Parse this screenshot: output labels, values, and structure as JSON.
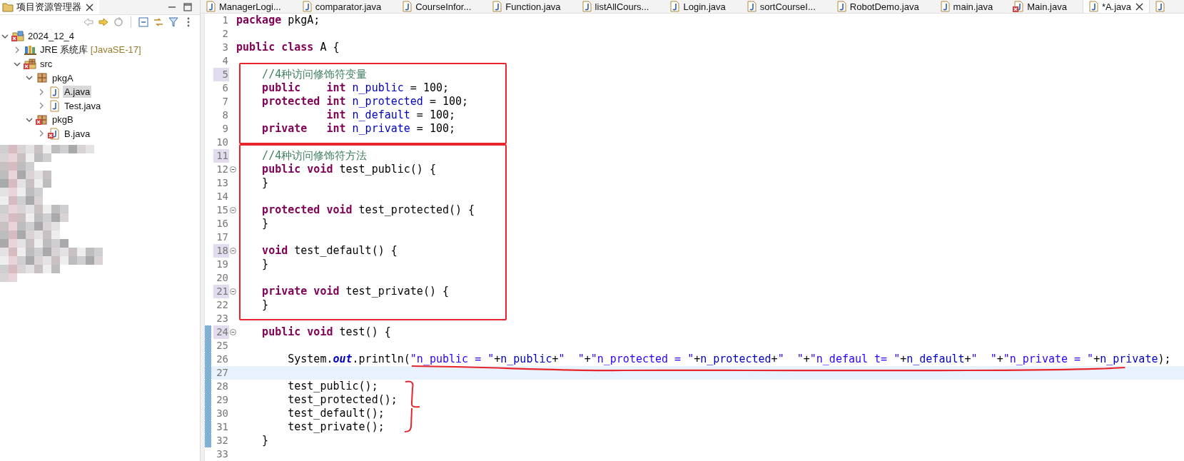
{
  "explorer": {
    "title": "项目资源管理器",
    "obscured": true,
    "tree": [
      {
        "label": "2024_12_4",
        "kind": "project",
        "error": true,
        "expanded": true,
        "selected": false,
        "children": [
          {
            "label": "JRE 系统库",
            "decoration": "[JavaSE-17]",
            "kind": "library",
            "error": false,
            "expanded": false,
            "selected": false
          },
          {
            "label": "src",
            "kind": "source-folder",
            "error": true,
            "expanded": true,
            "selected": false,
            "children": [
              {
                "label": "pkgA",
                "kind": "package",
                "error": false,
                "expanded": true,
                "selected": false,
                "children": [
                  {
                    "label": "A.java",
                    "kind": "java-file",
                    "error": false,
                    "expanded": false,
                    "selected": true
                  },
                  {
                    "label": "Test.java",
                    "kind": "java-file",
                    "error": false,
                    "expanded": false,
                    "selected": false
                  }
                ]
              },
              {
                "label": "pkgB",
                "kind": "package",
                "error": true,
                "expanded": true,
                "selected": false,
                "children": [
                  {
                    "label": "B.java",
                    "kind": "java-file",
                    "error": true,
                    "expanded": false,
                    "selected": false
                  }
                ]
              }
            ]
          }
        ]
      }
    ]
  },
  "editor": {
    "tabs": [
      {
        "label": "ManagerLogi...",
        "selected": false,
        "error": false
      },
      {
        "label": "comparator.java",
        "selected": false,
        "error": false
      },
      {
        "label": "CourseInfor...",
        "selected": false,
        "error": false
      },
      {
        "label": "Function.java",
        "selected": false,
        "error": false
      },
      {
        "label": "listAllCours...",
        "selected": false,
        "error": false
      },
      {
        "label": "Login.java",
        "selected": false,
        "error": false
      },
      {
        "label": "sortCourseI...",
        "selected": false,
        "error": false
      },
      {
        "label": "RobotDemo.java",
        "selected": false,
        "error": false
      },
      {
        "label": "main.java",
        "selected": false,
        "error": false
      },
      {
        "label": "Main.java",
        "selected": false,
        "error": true
      },
      {
        "label": "*A.java",
        "selected": true,
        "error": false
      },
      {
        "selected": false,
        "error": false
      }
    ],
    "lines": [
      {
        "number": "1",
        "tokens": [
          {
            "kind": "keyword",
            "text": "package"
          },
          {
            "kind": "plain",
            "text": " pkgA;"
          }
        ],
        "current": false,
        "changed": false,
        "marked": false,
        "foldable": false
      },
      {
        "number": "2",
        "current": false,
        "changed": false,
        "marked": false,
        "foldable": false
      },
      {
        "number": "3",
        "tokens": [
          {
            "kind": "keyword",
            "text": "public"
          },
          {
            "kind": "keyword",
            "text": " class"
          },
          {
            "kind": "plain",
            "text": " A {"
          }
        ],
        "current": false,
        "changed": false,
        "marked": false,
        "foldable": false
      },
      {
        "number": "4",
        "current": false,
        "changed": false,
        "marked": false,
        "foldable": false
      },
      {
        "number": "5",
        "tokens": [
          {
            "kind": "comment",
            "text": "    //4种访问修饰符变量"
          }
        ],
        "current": false,
        "changed": false,
        "marked": true,
        "foldable": false
      },
      {
        "number": "6",
        "tokens": [
          {
            "kind": "keyword",
            "text": "    public"
          },
          {
            "kind": "keyword",
            "text": "    int"
          },
          {
            "kind": "field",
            "text": " n_public"
          },
          {
            "kind": "plain",
            "text": " = 100;"
          }
        ],
        "current": false,
        "changed": false,
        "marked": false,
        "foldable": false
      },
      {
        "number": "7",
        "tokens": [
          {
            "kind": "keyword",
            "text": "    protected"
          },
          {
            "kind": "keyword",
            "text": " int"
          },
          {
            "kind": "field",
            "text": " n_protected"
          },
          {
            "kind": "plain",
            "text": " = 100;"
          }
        ],
        "current": false,
        "changed": false,
        "marked": false,
        "foldable": false
      },
      {
        "number": "8",
        "tokens": [
          {
            "kind": "keyword",
            "text": "              int"
          },
          {
            "kind": "field",
            "text": " n_default"
          },
          {
            "kind": "plain",
            "text": " = 100;"
          }
        ],
        "current": false,
        "changed": false,
        "marked": false,
        "foldable": false
      },
      {
        "number": "9",
        "tokens": [
          {
            "kind": "keyword",
            "text": "    private"
          },
          {
            "kind": "keyword",
            "text": "   int"
          },
          {
            "kind": "field",
            "text": " n_private"
          },
          {
            "kind": "plain",
            "text": " = 100;"
          }
        ],
        "current": false,
        "changed": false,
        "marked": false,
        "foldable": false
      },
      {
        "number": "10",
        "current": false,
        "changed": false,
        "marked": false,
        "foldable": false
      },
      {
        "number": "11",
        "tokens": [
          {
            "kind": "comment",
            "text": "    //4种访问修饰符方法"
          }
        ],
        "current": false,
        "changed": false,
        "marked": true,
        "foldable": false
      },
      {
        "number": "12",
        "tokens": [
          {
            "kind": "keyword",
            "text": "    public"
          },
          {
            "kind": "keyword",
            "text": " void"
          },
          {
            "kind": "plain",
            "text": " test_public() {"
          }
        ],
        "current": false,
        "changed": false,
        "marked": false,
        "foldable": true
      },
      {
        "number": "13",
        "tokens": [
          {
            "kind": "plain",
            "text": "    }"
          }
        ],
        "current": false,
        "changed": false,
        "marked": false,
        "foldable": false
      },
      {
        "number": "14",
        "current": false,
        "changed": false,
        "marked": false,
        "foldable": false
      },
      {
        "number": "15",
        "tokens": [
          {
            "kind": "keyword",
            "text": "    protected"
          },
          {
            "kind": "keyword",
            "text": " void"
          },
          {
            "kind": "plain",
            "text": " test_protected() {"
          }
        ],
        "current": false,
        "changed": false,
        "marked": false,
        "foldable": true
      },
      {
        "number": "16",
        "tokens": [
          {
            "kind": "plain",
            "text": "    }"
          }
        ],
        "current": false,
        "changed": false,
        "marked": false,
        "foldable": false
      },
      {
        "number": "17",
        "current": false,
        "changed": false,
        "marked": false,
        "foldable": false
      },
      {
        "number": "18",
        "tokens": [
          {
            "kind": "keyword",
            "text": "    void"
          },
          {
            "kind": "plain",
            "text": " test_default() {"
          }
        ],
        "current": false,
        "changed": false,
        "marked": true,
        "foldable": true
      },
      {
        "number": "19",
        "tokens": [
          {
            "kind": "plain",
            "text": "    }"
          }
        ],
        "current": false,
        "changed": false,
        "marked": false,
        "foldable": false
      },
      {
        "number": "20",
        "current": false,
        "changed": false,
        "marked": false,
        "foldable": false
      },
      {
        "number": "21",
        "tokens": [
          {
            "kind": "keyword",
            "text": "    private"
          },
          {
            "kind": "keyword",
            "text": " void"
          },
          {
            "kind": "plain",
            "text": " test_private() {"
          }
        ],
        "current": false,
        "changed": false,
        "marked": true,
        "foldable": true
      },
      {
        "number": "22",
        "tokens": [
          {
            "kind": "plain",
            "text": "    }"
          }
        ],
        "current": false,
        "changed": false,
        "marked": false,
        "foldable": false
      },
      {
        "number": "23",
        "current": false,
        "changed": false,
        "marked": false,
        "foldable": false
      },
      {
        "number": "24",
        "tokens": [
          {
            "kind": "keyword",
            "text": "    public"
          },
          {
            "kind": "keyword",
            "text": " void"
          },
          {
            "kind": "plain",
            "text": " test() {"
          }
        ],
        "current": false,
        "changed": true,
        "marked": true,
        "foldable": true
      },
      {
        "number": "25",
        "current": false,
        "changed": true,
        "marked": false,
        "foldable": false
      },
      {
        "number": "26",
        "tokens": [
          {
            "kind": "plain",
            "text": "        System."
          },
          {
            "kind": "static",
            "text": "out"
          },
          {
            "kind": "plain",
            "text": ".println("
          },
          {
            "kind": "string",
            "text": "\"n_public = \""
          },
          {
            "kind": "plain",
            "text": "+"
          },
          {
            "kind": "field",
            "text": "n_public"
          },
          {
            "kind": "plain",
            "text": "+"
          },
          {
            "kind": "string",
            "text": "\"  \""
          },
          {
            "kind": "plain",
            "text": "+"
          },
          {
            "kind": "string",
            "text": "\"n_protected = \""
          },
          {
            "kind": "plain",
            "text": "+"
          },
          {
            "kind": "field",
            "text": "n_protected"
          },
          {
            "kind": "plain",
            "text": "+"
          },
          {
            "kind": "string",
            "text": "\"  \""
          },
          {
            "kind": "plain",
            "text": "+"
          },
          {
            "kind": "string",
            "text": "\"n_defaul t= \""
          },
          {
            "kind": "plain",
            "text": "+"
          },
          {
            "kind": "field",
            "text": "n_default"
          },
          {
            "kind": "plain",
            "text": "+"
          },
          {
            "kind": "string",
            "text": "\"  \""
          },
          {
            "kind": "plain",
            "text": "+"
          },
          {
            "kind": "string",
            "text": "\"n_private = \""
          },
          {
            "kind": "plain",
            "text": "+"
          },
          {
            "kind": "field",
            "text": "n_private"
          },
          {
            "kind": "plain",
            "text": ");"
          }
        ],
        "current": false,
        "changed": true,
        "marked": false,
        "foldable": false
      },
      {
        "number": "27",
        "current": true,
        "changed": true,
        "marked": false,
        "foldable": false
      },
      {
        "number": "28",
        "tokens": [
          {
            "kind": "plain",
            "text": "        test_public();"
          }
        ],
        "current": false,
        "changed": true,
        "marked": false,
        "foldable": false
      },
      {
        "number": "29",
        "tokens": [
          {
            "kind": "plain",
            "text": "        test_protected();"
          }
        ],
        "current": false,
        "changed": true,
        "marked": false,
        "foldable": false
      },
      {
        "number": "30",
        "tokens": [
          {
            "kind": "plain",
            "text": "        test_default();"
          }
        ],
        "current": false,
        "changed": true,
        "marked": false,
        "foldable": false
      },
      {
        "number": "31",
        "tokens": [
          {
            "kind": "plain",
            "text": "        test_private();"
          }
        ],
        "current": false,
        "changed": true,
        "marked": false,
        "foldable": false
      },
      {
        "number": "32",
        "tokens": [
          {
            "kind": "plain",
            "text": "    }"
          }
        ],
        "current": false,
        "changed": true,
        "marked": false,
        "foldable": false
      },
      {
        "number": "33",
        "current": false,
        "changed": false,
        "marked": false,
        "foldable": false
      }
    ],
    "annotations": [
      {
        "kind": "box"
      },
      {
        "kind": "box"
      },
      {
        "kind": "underline"
      },
      {
        "kind": "brace"
      }
    ]
  }
}
